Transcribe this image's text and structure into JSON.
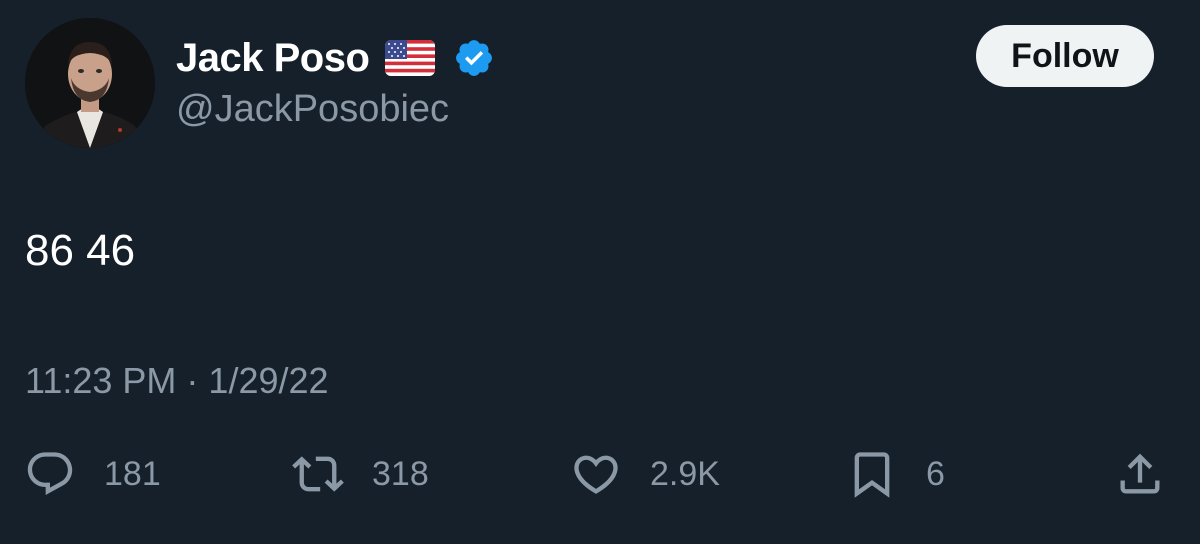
{
  "author": {
    "display_name": "Jack Poso",
    "handle": "@JackPosobiec",
    "flag_emoji_icon": "us-flag-icon",
    "verified_icon": "verified-badge-icon",
    "verified_color": "#1d9bf0"
  },
  "follow_button": {
    "label": "Follow"
  },
  "tweet": {
    "text": "86 46",
    "time": "11:23 PM",
    "separator": "·",
    "date": "1/29/22"
  },
  "actions": {
    "reply": {
      "icon": "reply-icon",
      "count": "181"
    },
    "retweet": {
      "icon": "retweet-icon",
      "count": "318"
    },
    "like": {
      "icon": "heart-icon",
      "count": "2.9K"
    },
    "bookmark": {
      "icon": "bookmark-icon",
      "count": "6"
    },
    "share": {
      "icon": "share-icon"
    }
  },
  "colors": {
    "background": "#15202b",
    "primary_text": "#ffffff",
    "secondary_text": "#8b98a5",
    "button_bg": "#eff3f4",
    "button_text": "#0f1419"
  }
}
